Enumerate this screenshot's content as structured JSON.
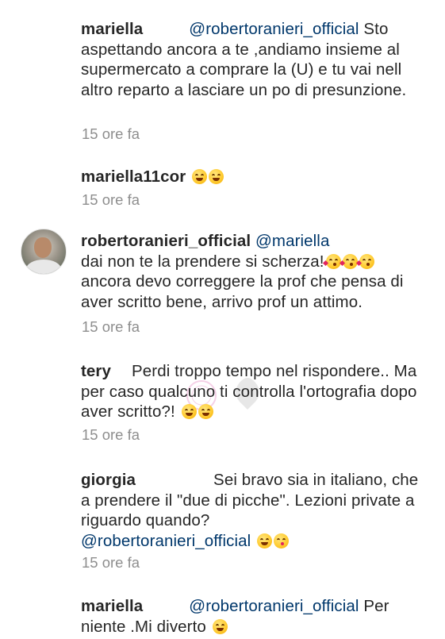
{
  "comments": [
    {
      "username": "mariella",
      "mention": "@robertoranieri_official",
      "text_after_mention": " Sto aspettando ancora a te ,andiamo insieme al supermercato a comprare la (U) e  tu vai nell altro reparto a lasciare un po di presunzione.",
      "time": "15 ore fa"
    },
    {
      "username": "mariella11cor",
      "emojis": [
        "grinning-squint",
        "grinning-squint"
      ],
      "time": "15 ore fa"
    },
    {
      "username": "robertoranieri_official",
      "mention": "@mariella",
      "text_line1": "dai non te la prendere si scherza!",
      "emojis": [
        "kissing-heart",
        "kissing-heart",
        "kissing-heart"
      ],
      "text_line2": "ancora devo correggere la prof che pensa di aver scritto bene, arrivo prof un attimo.",
      "time": "15 ore fa",
      "avatar": "profile-photo"
    },
    {
      "username": "tery",
      "text": "Perdi troppo tempo nel rispondere.. Ma per caso qualcuno ti controlla l'ortografia dopo aver scritto?!",
      "emojis": [
        "grinning-squint",
        "grinning-squint"
      ],
      "time": "15 ore fa"
    },
    {
      "username": "giorgia",
      "text": "Sei bravo sia in italiano, che a prendere il \"due di picche\". Lezioni private a riguardo quando?",
      "mention": "@robertoranieri_official",
      "emojis": [
        "grinning-squint",
        "winking-tongue"
      ],
      "time": "15 ore fa"
    },
    {
      "username": "mariella",
      "mention": "@robertoranieri_official",
      "text": " Per niente .Mi diverto",
      "emojis": [
        "grinning-squint"
      ]
    }
  ],
  "colors": {
    "text": "#262626",
    "mention": "#00376b",
    "timestamp": "#8e8e8e"
  }
}
